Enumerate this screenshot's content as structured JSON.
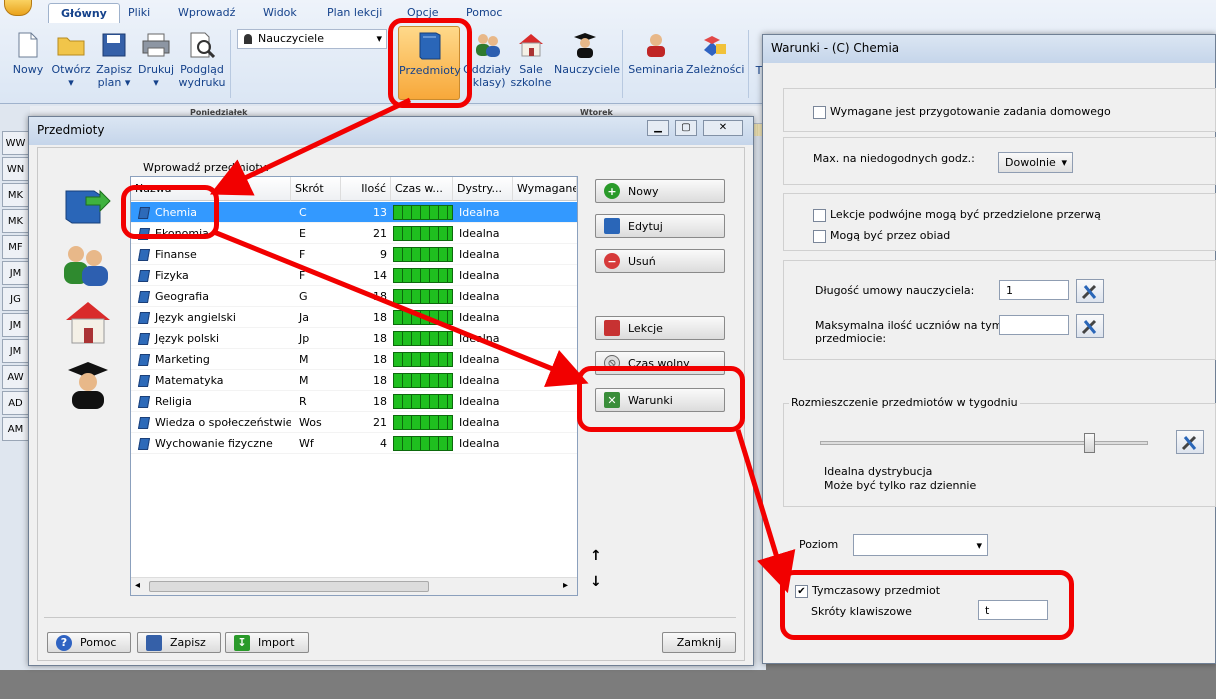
{
  "ribbon": {
    "tabs": [
      "Główny",
      "Pliki",
      "Wprowadź",
      "Widok",
      "Plan lekcji",
      "Opcje",
      "Pomoc"
    ],
    "buttons": {
      "nowy": "Nowy",
      "otworz": "Otwórz",
      "zapisz_1": "Zapisz",
      "zapisz_2": "plan",
      "drukuj": "Drukuj",
      "podglad_1": "Podgląd",
      "podglad_2": "wydruku",
      "przedmioty": "Przedmioty",
      "oddzialy_1": "Oddziały",
      "oddzialy_2": "(klasy)",
      "sale_1": "Sale",
      "sale_2": "szkolne",
      "nauczyciele": "Nauczyciele",
      "seminaria": "Seminaria",
      "zaleznosci": "Zależności",
      "t": "T"
    },
    "dropdown_value": "Nauczyciele"
  },
  "background": {
    "days": [
      "Poniedziałek",
      "Wtorek"
    ],
    "teachers": [
      "WW",
      "WN",
      "MK",
      "MK",
      "MF",
      "JM",
      "JG",
      "JM",
      "JM",
      "AW",
      "AD",
      "AM"
    ]
  },
  "przedmioty": {
    "title": "Przedmioty",
    "input_label": "Wprowadź przedmioty:",
    "columns": [
      "Nazwa",
      "Skrót",
      "Ilość",
      "Czas w...",
      "Dystry...",
      "Wymagane j"
    ],
    "rows": [
      {
        "name": "Chemia",
        "abbr": "C",
        "count": "13",
        "dist": "Idealna"
      },
      {
        "name": "Ekonomia",
        "abbr": "E",
        "count": "21",
        "dist": "Idealna"
      },
      {
        "name": "Finanse",
        "abbr": "F",
        "count": "9",
        "dist": "Idealna"
      },
      {
        "name": "Fizyka",
        "abbr": "F",
        "count": "14",
        "dist": "Idealna"
      },
      {
        "name": "Geografia",
        "abbr": "G",
        "count": "18",
        "dist": "Idealna"
      },
      {
        "name": "Język angielski",
        "abbr": "Ja",
        "count": "18",
        "dist": "Idealna"
      },
      {
        "name": "Język polski",
        "abbr": "Jp",
        "count": "18",
        "dist": "Idealna"
      },
      {
        "name": "Marketing",
        "abbr": "M",
        "count": "18",
        "dist": "Idealna"
      },
      {
        "name": "Matematyka",
        "abbr": "M",
        "count": "18",
        "dist": "Idealna"
      },
      {
        "name": "Religia",
        "abbr": "R",
        "count": "18",
        "dist": "Idealna"
      },
      {
        "name": "Wiedza o społeczeństwie",
        "abbr": "Wos",
        "count": "21",
        "dist": "Idealna"
      },
      {
        "name": "Wychowanie fizyczne",
        "abbr": "Wf",
        "count": "4",
        "dist": "Idealna"
      }
    ],
    "buttons": {
      "nowy": "Nowy",
      "edytuj": "Edytuj",
      "usun": "Usuń",
      "lekcje": "Lekcje",
      "czas": "Czas wolny",
      "warunki": "Warunki"
    },
    "footer": {
      "pomoc": "Pomoc",
      "zapisz": "Zapisz",
      "import": "Import",
      "zamknij": "Zamknij"
    }
  },
  "warunki": {
    "title": "Warunki - (C) Chemia",
    "homework_label": "Wymagane jest przygotowanie zadania domowego",
    "max_label": "Max. na niedogodnych godz.:",
    "max_value": "Dowolnie",
    "double_label": "Lekcje podwójne mogą być przedzielone przerwą",
    "lunch_label": "Mogą być przez obiad",
    "contract_label": "Długość umowy nauczyciela:",
    "contract_value": "1",
    "max_students_label_1": "Maksymalna ilość uczniów na tym",
    "max_students_label_2": "przedmiocie:",
    "max_students_value": "",
    "distribution_title": "Rozmieszczenie przedmiotów w tygodniu",
    "distribution_value": 0.82,
    "dist_text_1": "Idealna dystrybucja",
    "dist_text_2": "Może być tylko raz dziennie",
    "level_label": "Poziom",
    "level_value": "",
    "temporary_label": "Tymczasowy przedmiot",
    "temporary_checked": true,
    "shortcut_label": "Skróty klawiszowe",
    "shortcut_value": "t"
  }
}
